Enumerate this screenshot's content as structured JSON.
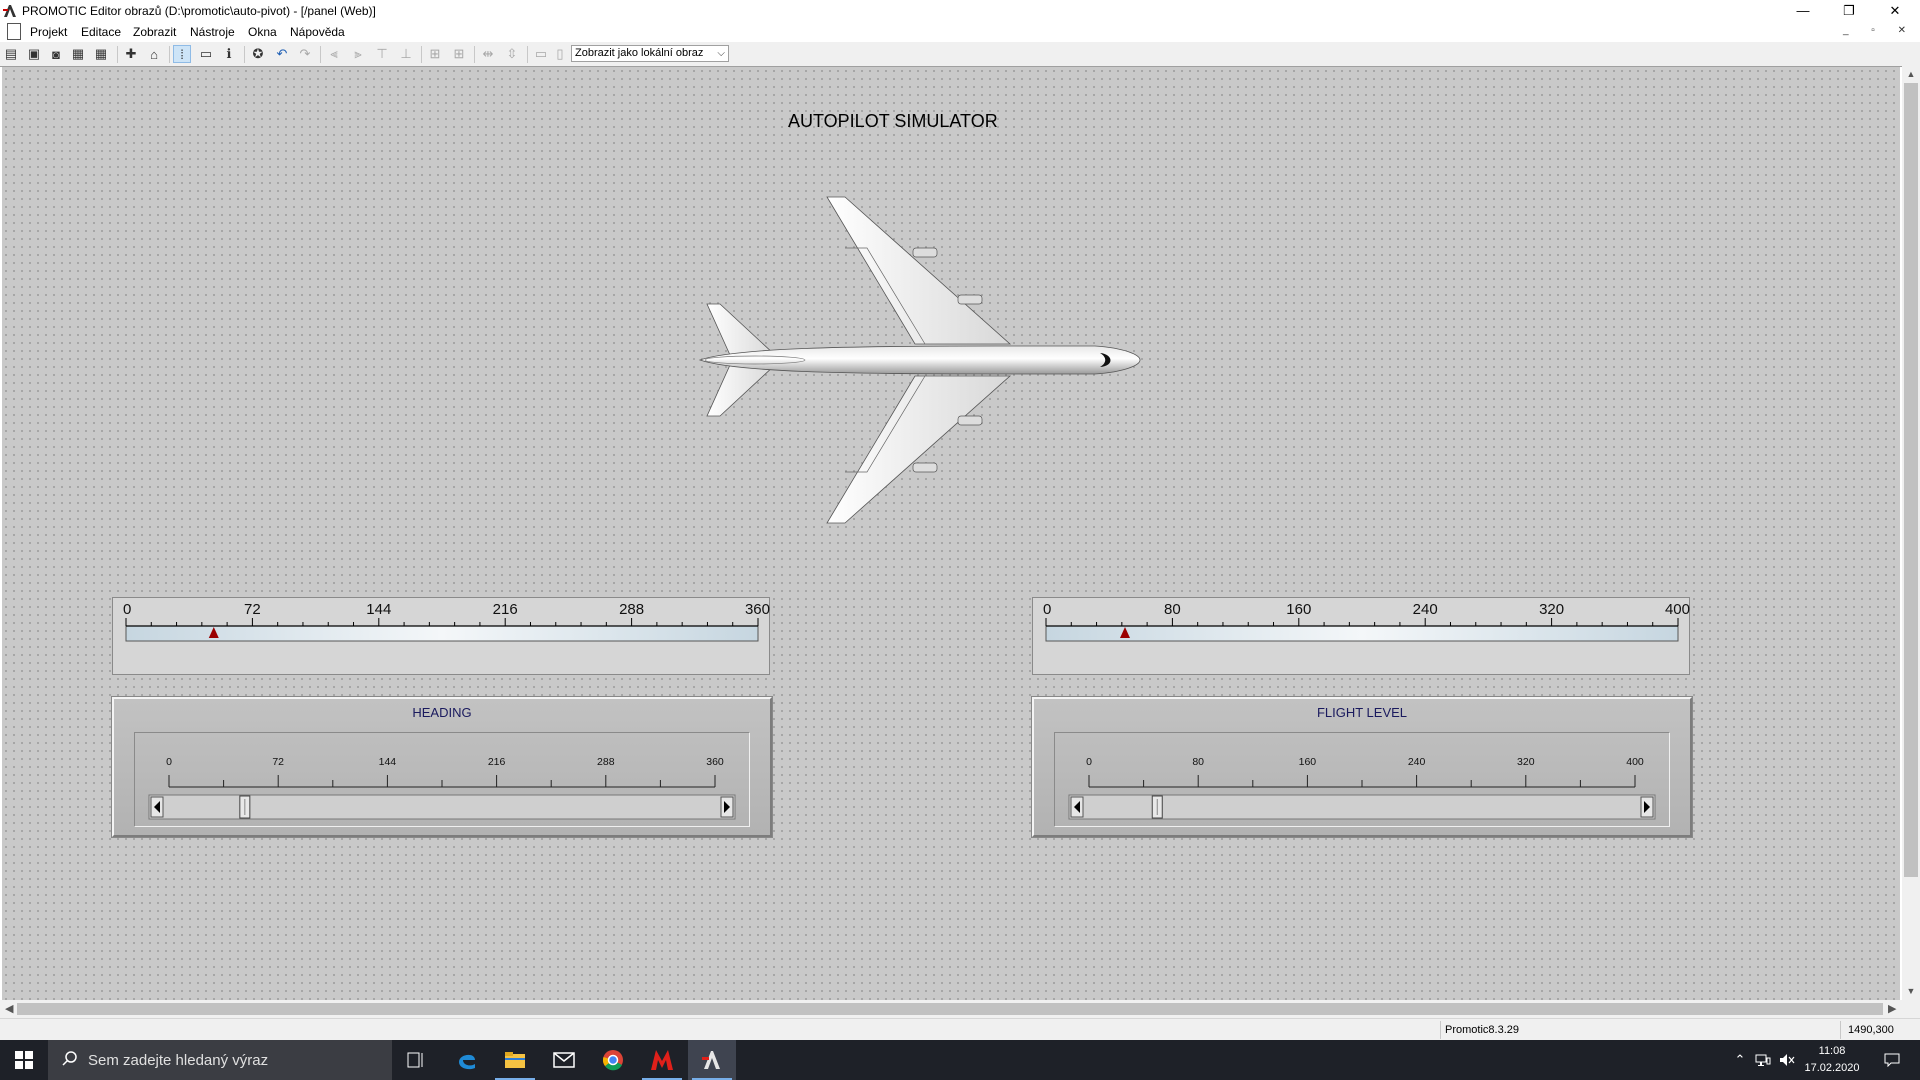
{
  "window": {
    "title": "PROMOTIC Editor obrazů (D:\\promotic\\auto-pivot)  - [/panel (Web)]",
    "minimize": "—",
    "restore": "❐",
    "close": "✕"
  },
  "menu": {
    "items": [
      "Projekt",
      "Editace",
      "Zobrazit",
      "Nástroje",
      "Okna",
      "Nápověda"
    ]
  },
  "toolbar": {
    "view_select": "Zobrazit jako lokální obraz",
    "chevron": "⌵",
    "icons": [
      "new-image-icon",
      "save-icon",
      "save-all-icon",
      "grid-icon",
      "grid2-icon",
      "add-icon",
      "home-icon",
      "snap-grid-icon",
      "panel-icon",
      "info-icon",
      "globe-icon",
      "undo-icon",
      "redo-icon",
      "align-left-icon",
      "align-right-icon",
      "align-top-icon",
      "align-bottom-icon",
      "center-h-icon",
      "center-v-icon",
      "space-h-icon",
      "space-v-icon",
      "same-width-icon",
      "same-height-icon"
    ]
  },
  "canvas": {
    "title": "AUTOPILOT SIMULATOR",
    "indicators": [
      {
        "name": "heading-indicator",
        "labels": [
          "0",
          "72",
          "144",
          "216",
          "288",
          "360"
        ],
        "max": 360,
        "value": 50
      },
      {
        "name": "flight-level-indicator",
        "labels": [
          "0",
          "80",
          "160",
          "240",
          "320",
          "400"
        ],
        "max": 400,
        "value": 50
      }
    ],
    "groups": [
      {
        "title": "HEADING",
        "labels": [
          "0",
          "72",
          "144",
          "216",
          "288",
          "360"
        ],
        "max": 360,
        "value": 50
      },
      {
        "title": "FLIGHT LEVEL",
        "labels": [
          "0",
          "80",
          "160",
          "240",
          "320",
          "400"
        ],
        "max": 400,
        "value": 50
      }
    ]
  },
  "statusbar": {
    "version": "Promotic8.3.29",
    "coords": "1490,300"
  },
  "taskbar": {
    "search_placeholder": "Sem zadejte hledaný výraz",
    "time": "11:08",
    "date": "17.02.2020"
  },
  "colors": {
    "canvas": "#c9c9c9",
    "indicator_marker": "#9b0000",
    "group_title": "#1a1a5e",
    "taskbar": "#1e2128"
  }
}
